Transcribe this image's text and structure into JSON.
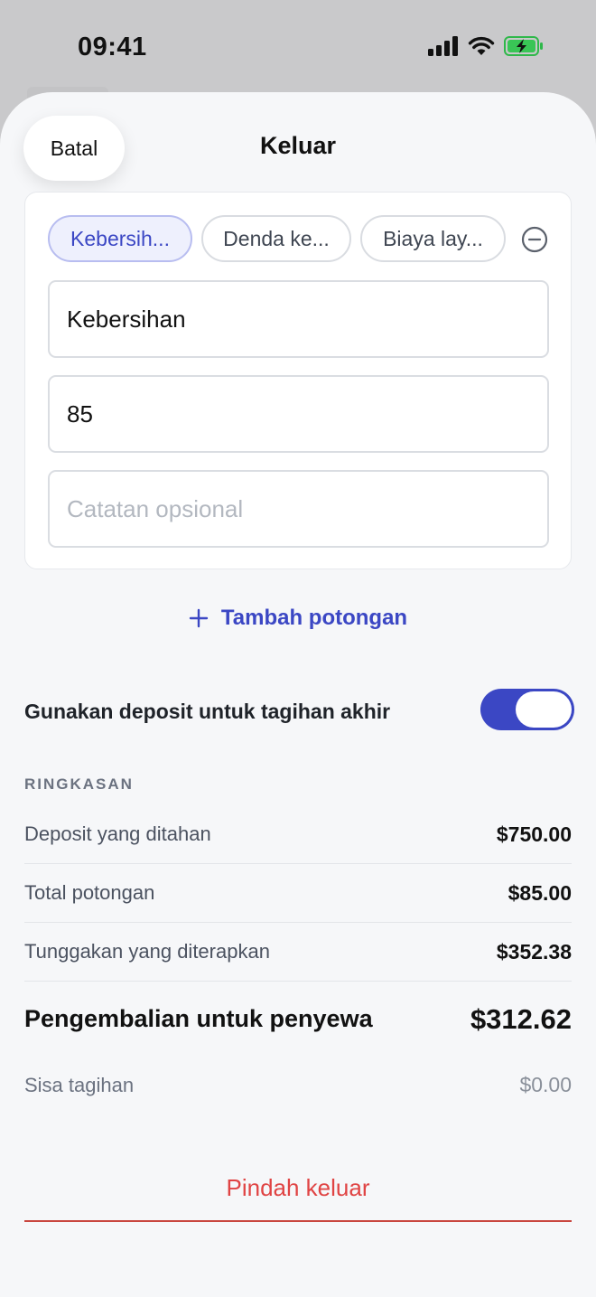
{
  "status_bar": {
    "time": "09:41"
  },
  "header": {
    "cancel_label": "Batal",
    "title": "Keluar"
  },
  "deduction": {
    "chips": [
      {
        "label": "Kebersih...",
        "active": true
      },
      {
        "label": "Denda ke...",
        "active": false
      },
      {
        "label": "Biaya lay...",
        "active": false
      }
    ],
    "name_value": "Kebersihan",
    "amount_value": "85",
    "note_placeholder": "Catatan opsional"
  },
  "add_deduction_label": "Tambah potongan",
  "use_deposit": {
    "label": "Gunakan deposit untuk tagihan akhir",
    "enabled": true
  },
  "summary": {
    "title": "RINGKASAN",
    "rows": [
      {
        "label": "Deposit yang ditahan",
        "value": "$750.00"
      },
      {
        "label": "Total potongan",
        "value": "$85.00"
      },
      {
        "label": "Tunggakan yang diterapkan",
        "value": "$352.38"
      }
    ],
    "refund": {
      "label": "Pengembalian untuk penyewa",
      "value": "$312.62"
    },
    "balance": {
      "label": "Sisa tagihan",
      "value": "$0.00"
    }
  },
  "move_out_label": "Pindah keluar",
  "colors": {
    "accent": "#3b47c4",
    "danger": "#e04444",
    "chip_active_bg": "#eef0fd"
  }
}
